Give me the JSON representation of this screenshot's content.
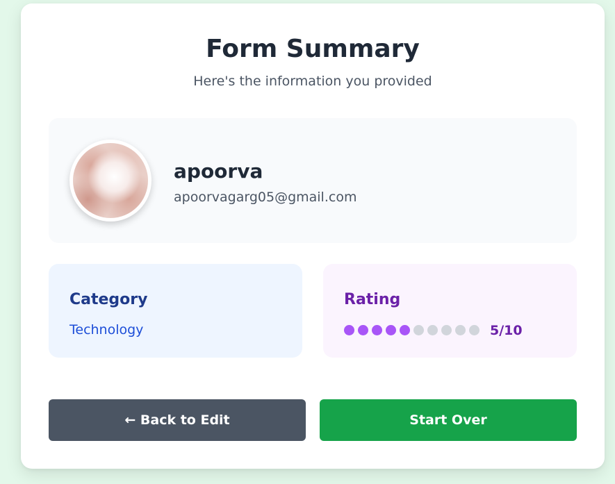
{
  "header": {
    "title": "Form Summary",
    "subtitle": "Here's the information you provided"
  },
  "profile": {
    "name": "apoorva",
    "email": "apoorvagarg05@gmail.com"
  },
  "category": {
    "label": "Category",
    "value": "Technology"
  },
  "rating": {
    "label": "Rating",
    "value": 5,
    "max": 10,
    "text": "5/10"
  },
  "actions": {
    "back_label": "← Back to Edit",
    "start_over_label": "Start Over"
  },
  "colors": {
    "page_background": "#e3f8ea",
    "rating_filled": "#a855f7",
    "rating_empty": "#d1d5db",
    "back_button": "#4b5563",
    "start_over_button": "#16a34a"
  }
}
